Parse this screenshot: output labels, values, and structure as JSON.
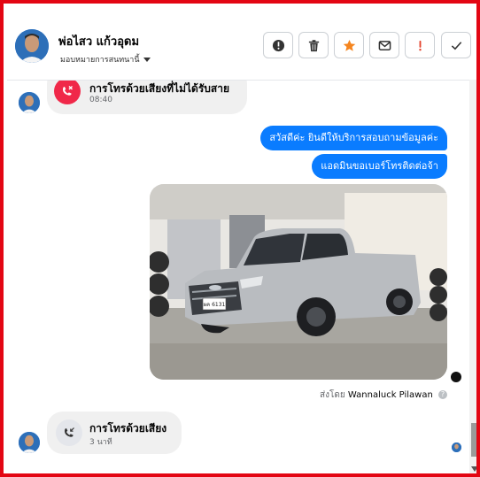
{
  "header": {
    "contact_name": "พ่อไสว แก้วอุดม",
    "assign_label": "มอบหมายการสนทนานี้",
    "actions": [
      {
        "icon": "alert-circle-icon"
      },
      {
        "icon": "trash-icon"
      },
      {
        "icon": "star-icon"
      },
      {
        "icon": "mail-icon"
      },
      {
        "icon": "exclamation-icon"
      },
      {
        "icon": "check-icon"
      }
    ]
  },
  "messages": {
    "missed_call": {
      "title": "การโทรด้วยเสียงที่ไม่ได้รับสาย",
      "time": "08:40"
    },
    "outgoing": [
      "สวัสดีค่ะ  ยินดีให้บริการสอบถามข้อมูลค่ะ",
      "แอดมินขอเบอร์โทรติดต่อจ้า"
    ],
    "photo": {
      "subject": "silver-pickup-truck",
      "plate": "ผค 6131"
    },
    "sent_by_prefix": "ส่งโดย",
    "sent_by_name": "Wannaluck Pilawan",
    "voice_call": {
      "title": "การโทรด้วยเสียง",
      "duration": "3 นาที"
    }
  },
  "colors": {
    "accent": "#0a7cff",
    "missed": "#f02849",
    "star": "#f5851f",
    "frame": "#e30613"
  }
}
